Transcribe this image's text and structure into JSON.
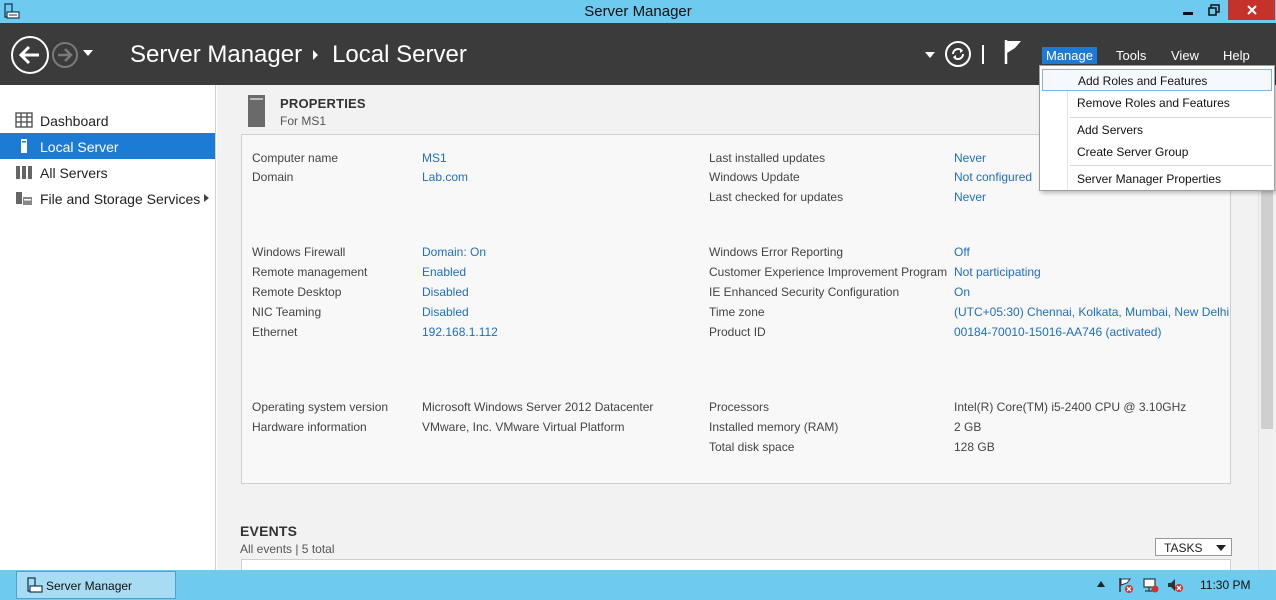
{
  "window": {
    "title": "Server Manager"
  },
  "header": {
    "breadcrumb": [
      "Server Manager",
      "Local Server"
    ],
    "menus": [
      "Manage",
      "Tools",
      "View",
      "Help"
    ]
  },
  "manage_menu": {
    "items": [
      "Add Roles and Features",
      "Remove Roles and Features",
      "Add Servers",
      "Create Server Group",
      "Server Manager Properties"
    ]
  },
  "sidebar": {
    "items": [
      {
        "label": "Dashboard",
        "icon": "dashboard-icon"
      },
      {
        "label": "Local Server",
        "icon": "server-icon"
      },
      {
        "label": "All Servers",
        "icon": "servers-icon"
      },
      {
        "label": "File and Storage Services",
        "icon": "storage-icon"
      }
    ],
    "active": "Local Server"
  },
  "properties": {
    "title": "PROPERTIES",
    "subtitle": "For MS1",
    "left_group1": [
      {
        "label": "Computer name",
        "value": "MS1"
      },
      {
        "label": "Domain",
        "value": "Lab.com"
      }
    ],
    "left_group2": [
      {
        "label": "Windows Firewall",
        "value": "Domain: On"
      },
      {
        "label": "Remote management",
        "value": "Enabled"
      },
      {
        "label": "Remote Desktop",
        "value": "Disabled"
      },
      {
        "label": "NIC Teaming",
        "value": "Disabled"
      },
      {
        "label": "Ethernet",
        "value": "192.168.1.112"
      }
    ],
    "left_group3": [
      {
        "label": "Operating system version",
        "value": "Microsoft Windows Server 2012 Datacenter"
      },
      {
        "label": "Hardware information",
        "value": "VMware, Inc. VMware Virtual Platform"
      }
    ],
    "right_group1": [
      {
        "label": "Last installed updates",
        "value": "Never"
      },
      {
        "label": "Windows Update",
        "value": "Not configured"
      },
      {
        "label": "Last checked for updates",
        "value": "Never"
      }
    ],
    "right_group2": [
      {
        "label": "Windows Error Reporting",
        "value": "Off"
      },
      {
        "label": "Customer Experience Improvement Program",
        "value": "Not participating"
      },
      {
        "label": "IE Enhanced Security Configuration",
        "value": "On"
      },
      {
        "label": "Time zone",
        "value": "(UTC+05:30) Chennai, Kolkata, Mumbai, New Delhi"
      },
      {
        "label": "Product ID",
        "value": "00184-70010-15016-AA746 (activated)"
      }
    ],
    "right_group3": [
      {
        "label": "Processors",
        "value": "Intel(R) Core(TM) i5-2400 CPU @ 3.10GHz"
      },
      {
        "label": "Installed memory (RAM)",
        "value": "2 GB"
      },
      {
        "label": "Total disk space",
        "value": "128 GB"
      }
    ]
  },
  "events": {
    "title": "EVENTS",
    "subtitle": "All events | 5 total",
    "tasks_label": "TASKS"
  },
  "taskbar": {
    "app_label": "Server Manager",
    "clock": "11:30 PM"
  },
  "colors": {
    "accent": "#1c7cd5",
    "titlebar": "#6ccbee",
    "header": "#3b3b3b",
    "link": "#1f6fbf"
  }
}
